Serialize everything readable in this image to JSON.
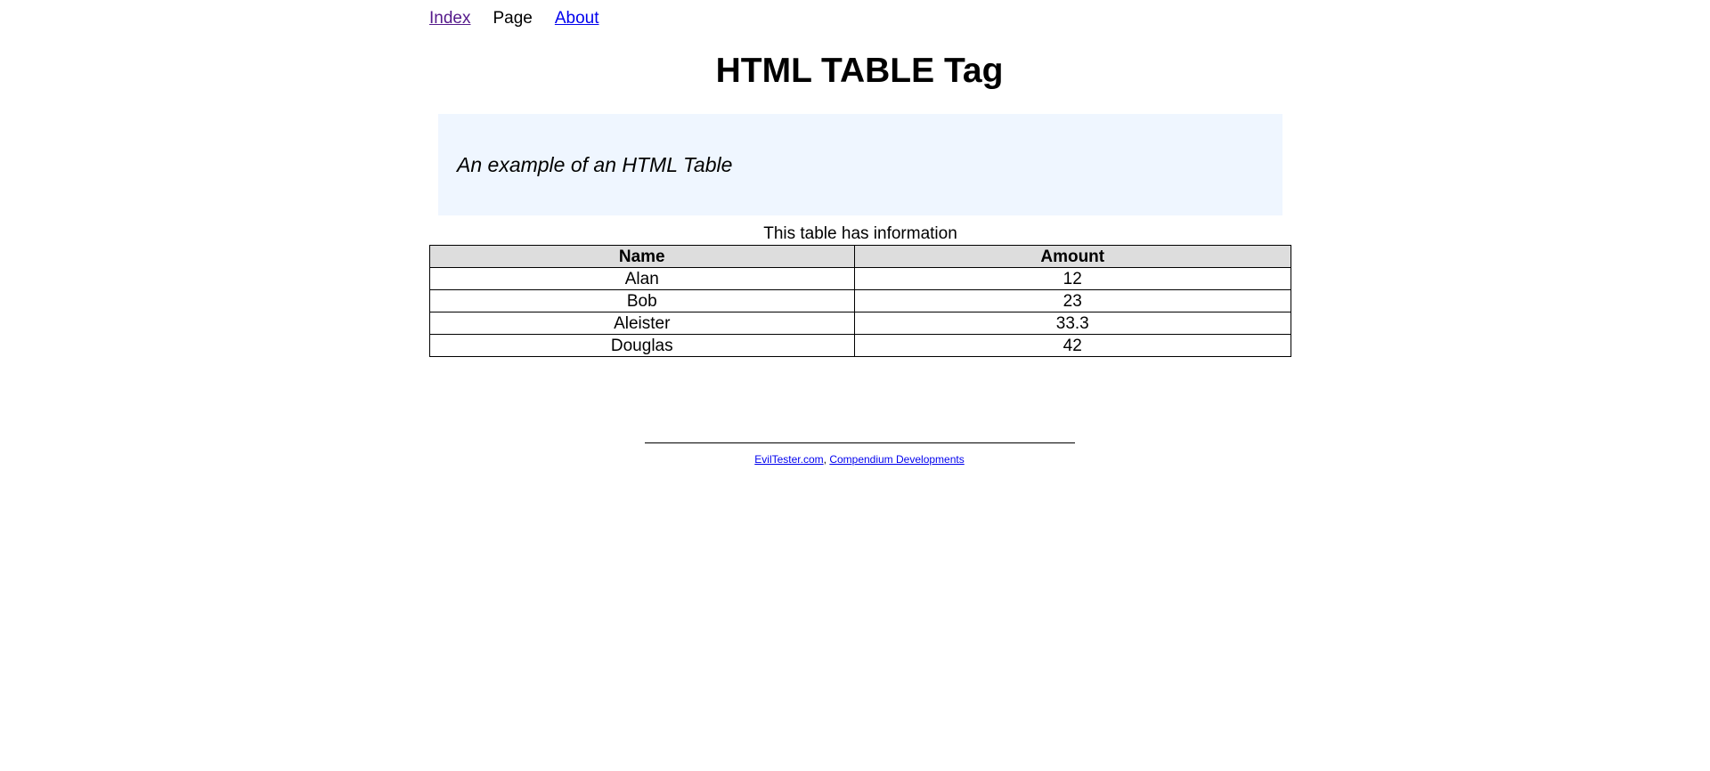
{
  "nav": {
    "index_label": "Index",
    "page_label": "Page",
    "about_label": "About"
  },
  "heading": "HTML TABLE Tag",
  "intro_text": "An example of an HTML Table",
  "table": {
    "caption": "This table has information",
    "headers": [
      "Name",
      "Amount"
    ],
    "rows": [
      [
        "Alan",
        "12"
      ],
      [
        "Bob",
        "23"
      ],
      [
        "Aleister",
        "33.3"
      ],
      [
        "Douglas",
        "42"
      ]
    ]
  },
  "footer": {
    "link1": "EvilTester.com",
    "separator": ", ",
    "link2": "Compendium Developments"
  },
  "colors": {
    "intro_background": "#eff6ff",
    "header_background": "#dddddd",
    "link": "#0000ee",
    "visited_link": "#551a8b"
  }
}
